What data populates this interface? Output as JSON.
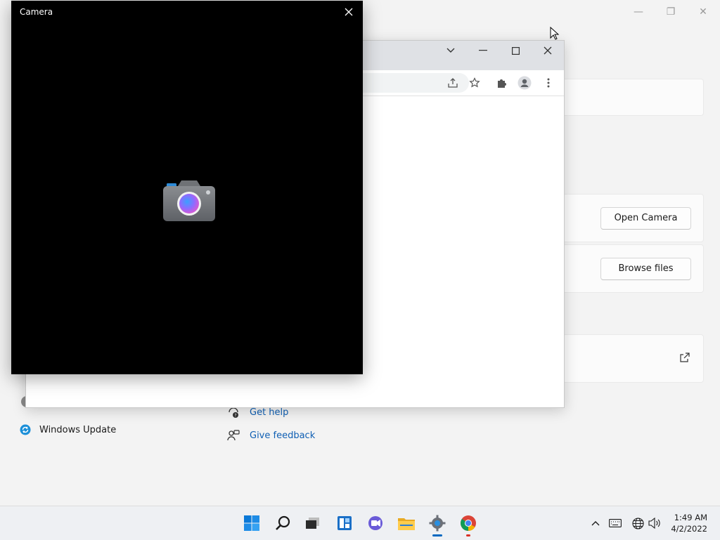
{
  "camera_window": {
    "title": "Camera"
  },
  "settings": {
    "open_camera_label": "Open Camera",
    "browse_files_label": "Browse files",
    "nav": {
      "windows_update": "Windows Update"
    },
    "links": {
      "get_help": "Get help",
      "give_feedback": "Give feedback"
    }
  },
  "taskbar": {
    "apps": [
      "start-icon",
      "search-icon",
      "task-view-icon",
      "widgets-icon",
      "chat-icon",
      "file-explorer-icon",
      "settings-icon",
      "chrome-icon"
    ],
    "clock_time": "1:49 AM",
    "clock_date": "4/2/2022"
  },
  "colors": {
    "accent": "#0067c0",
    "link": "#0f5fb3",
    "camera_bg": "#000000"
  }
}
